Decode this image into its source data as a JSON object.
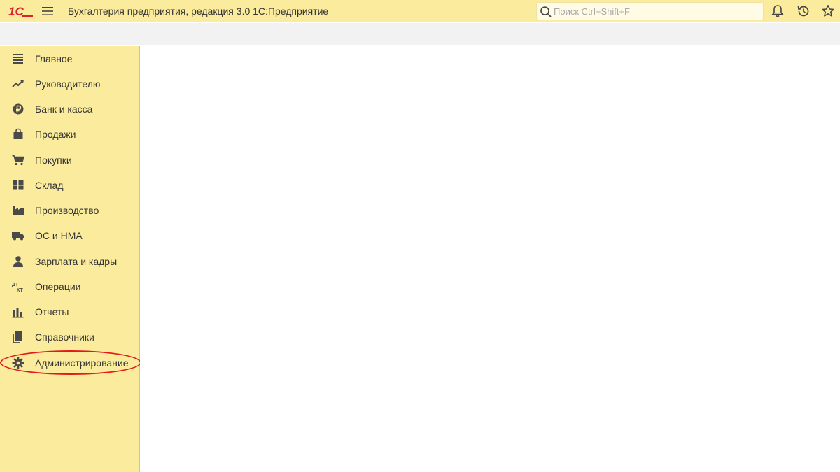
{
  "titlebar": {
    "logo_text": "1С",
    "app_title": "Бухгалтерия предприятия, редакция 3.0 1С:Предприятие",
    "search_placeholder": "Поиск Ctrl+Shift+F",
    "icons": [
      "bell-icon",
      "history-icon",
      "star-icon"
    ]
  },
  "sidebar": {
    "items": [
      {
        "label": "Главное",
        "icon": "list-icon"
      },
      {
        "label": "Руководителю",
        "icon": "trend-up-icon"
      },
      {
        "label": "Банк и касса",
        "icon": "ruble-icon"
      },
      {
        "label": "Продажи",
        "icon": "shopping-bag-icon"
      },
      {
        "label": "Покупки",
        "icon": "cart-icon"
      },
      {
        "label": "Склад",
        "icon": "warehouse-icon"
      },
      {
        "label": "Производство",
        "icon": "factory-icon"
      },
      {
        "label": "ОС и НМА",
        "icon": "truck-icon"
      },
      {
        "label": "Зарплата и кадры",
        "icon": "person-icon"
      },
      {
        "label": "Операции",
        "icon": "dt-kt-icon"
      },
      {
        "label": "Отчеты",
        "icon": "bar-chart-icon"
      },
      {
        "label": "Справочники",
        "icon": "books-icon"
      },
      {
        "label": "Администрирование",
        "icon": "gear-icon"
      }
    ],
    "highlighted_item": "Администрирование",
    "highlight_color": "#e41a1a"
  },
  "colors": {
    "panel_yellow": "#fbeb9c",
    "toolbar_gray": "#f2f2f2",
    "logo_red": "#d8232a",
    "icon_dark": "#4a4a4a"
  }
}
